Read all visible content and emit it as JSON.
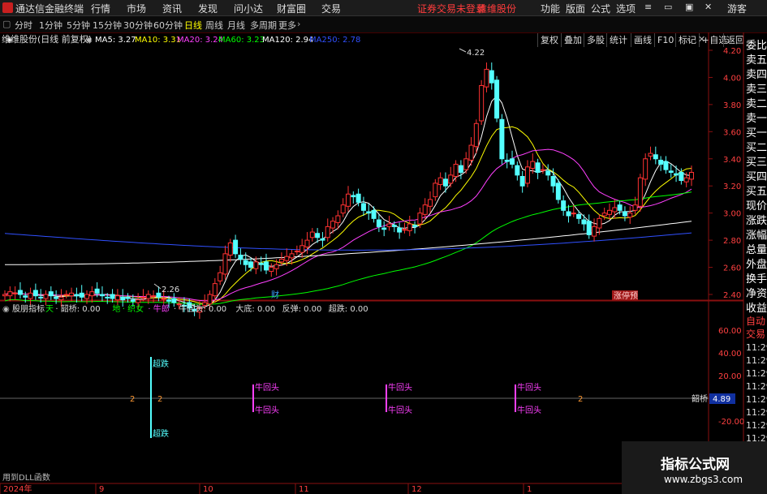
{
  "menubar": {
    "app_title": "通达信金融终端",
    "items": [
      "行情",
      "市场",
      "资讯",
      "发现",
      "问小达",
      "财富圈",
      "交易"
    ],
    "status_login": "证券交易未登录",
    "stock_name": "维维股份",
    "right_items": [
      "功能",
      "版面",
      "公式",
      "选项"
    ],
    "guest": "游客"
  },
  "periodbar": {
    "periods": [
      "分时",
      "1分钟",
      "5分钟",
      "15分钟",
      "30分钟",
      "60分钟",
      "日线",
      "周线",
      "月线",
      "多周期",
      "更多"
    ],
    "active": "日线",
    "tools": [
      "复权",
      "叠加",
      "多股",
      "统计",
      "画线",
      "F10",
      "标记",
      "+自选",
      "返回"
    ]
  },
  "main_legend": {
    "title": "维维股份(日线 前复权)",
    "ma": [
      {
        "label": "MA5: 3.27",
        "color": "#ffffff"
      },
      {
        "label": "MA10: 3.31",
        "color": "#ffff00"
      },
      {
        "label": "MA20: 3.24",
        "color": "#ff40ff"
      },
      {
        "label": "MA60: 3.23",
        "color": "#00ff00"
      },
      {
        "label": "MA120: 2.94",
        "color": "#ffffff"
      },
      {
        "label": "MA250: 2.78",
        "color": "#3050ff"
      }
    ]
  },
  "annotations": {
    "high": "4.22",
    "low": "2.26",
    "cai": "财",
    "zhangting": "涨停预"
  },
  "sub_legend": {
    "title": "股朋指标",
    "items": [
      {
        "label": "天",
        "color": "#00ff00"
      },
      {
        "label": "· 韶桥: 0.00",
        "color": "#dddddd"
      },
      {
        "label": "地",
        "color": "#00ff00"
      },
      {
        "label": "· 织女",
        "color": "#00ff00"
      },
      {
        "label": "· 牛郎",
        "color": "#ff40ff"
      },
      {
        "label": "· 牛回头: 0.00",
        "color": "#dddddd"
      },
      {
        "label": "大底: 0.00",
        "color": "#dddddd"
      },
      {
        "label": "反弹: 0.00",
        "color": "#dddddd"
      },
      {
        "label": "超跌: 0.00",
        "color": "#dddddd"
      }
    ],
    "marker_chaodie": "超跌",
    "marker_niuhuitou": "牛回头",
    "marker_two": "2",
    "queqiao_label": "韶桥",
    "queqiao_value": "4.89",
    "footer": "用到DLL函数"
  },
  "right_panel": [
    "委比",
    "卖五",
    "卖四",
    "卖三",
    "卖二",
    "卖一",
    "买一",
    "买二",
    "买三",
    "买四",
    "买五",
    "现价",
    "涨跌",
    "涨幅",
    "总量",
    "外盘",
    "换手",
    "净资",
    "收益"
  ],
  "right_lower": [
    "自动",
    "交易",
    "11:29",
    "11:29",
    "11:29",
    "11:29",
    "11:29",
    "11:29",
    "11:29",
    "11:29",
    "11:29",
    "11:29",
    "11:29",
    "11:29"
  ],
  "watermark": {
    "title": "指标公式网",
    "url": "www.zbgs3.com"
  },
  "colors": {
    "up": "#ff3232",
    "down": "#54ffff",
    "ma5": "#ffffff",
    "ma10": "#ffff00",
    "ma20": "#ff40ff",
    "ma60": "#00ff00",
    "ma120": "#ffffff",
    "ma250": "#3050ff"
  },
  "chart_data": {
    "type": "candlestick",
    "y_axis": {
      "ticks": [
        4.2,
        4.0,
        3.8,
        3.6,
        3.4,
        3.2,
        3.0,
        2.8,
        2.6,
        2.4
      ]
    },
    "sub_y_axis": {
      "ticks": [
        60.0,
        40.0,
        20.0,
        0,
        -20.0
      ]
    },
    "x_axis": {
      "labels": [
        "2024年",
        "9",
        "10",
        "11",
        "12",
        "1"
      ]
    },
    "closes": [
      2.4,
      2.42,
      2.41,
      2.4,
      2.38,
      2.41,
      2.39,
      2.38,
      2.4,
      2.39,
      2.37,
      2.38,
      2.4,
      2.41,
      2.39,
      2.38,
      2.4,
      2.42,
      2.41,
      2.39,
      2.38,
      2.37,
      2.39,
      2.36,
      2.37,
      2.35,
      2.36,
      2.38,
      2.4,
      2.39,
      2.38,
      2.37,
      2.35,
      2.34,
      2.33,
      2.32,
      2.3,
      2.28,
      2.3,
      2.34,
      2.4,
      2.48,
      2.56,
      2.7,
      2.78,
      2.7,
      2.66,
      2.62,
      2.6,
      2.64,
      2.62,
      2.58,
      2.6,
      2.62,
      2.66,
      2.68,
      2.7,
      2.72,
      2.76,
      2.8,
      2.86,
      2.82,
      2.8,
      2.9,
      2.94,
      2.98,
      3.06,
      3.14,
      3.12,
      3.08,
      3.02,
      3.0,
      2.96,
      2.9,
      2.88,
      2.92,
      2.9,
      2.86,
      2.88,
      2.92,
      2.9,
      3.0,
      3.06,
      3.1,
      3.22,
      3.26,
      3.2,
      3.28,
      3.36,
      3.3,
      3.4,
      3.5,
      3.66,
      3.94,
      4.06,
      3.96,
      3.7,
      3.4,
      3.38,
      3.36,
      3.28,
      3.2,
      3.34,
      3.38,
      3.3,
      3.32,
      3.28,
      3.2,
      3.1,
      3.02,
      2.98,
      3.0,
      2.96,
      2.92,
      2.84,
      2.9,
      2.96,
      3.0,
      3.02,
      3.04,
      3.02,
      2.98,
      3.0,
      3.06,
      3.26,
      3.4,
      3.44,
      3.4,
      3.36,
      3.32,
      3.3,
      3.28,
      3.24,
      3.26,
      3.3
    ]
  }
}
